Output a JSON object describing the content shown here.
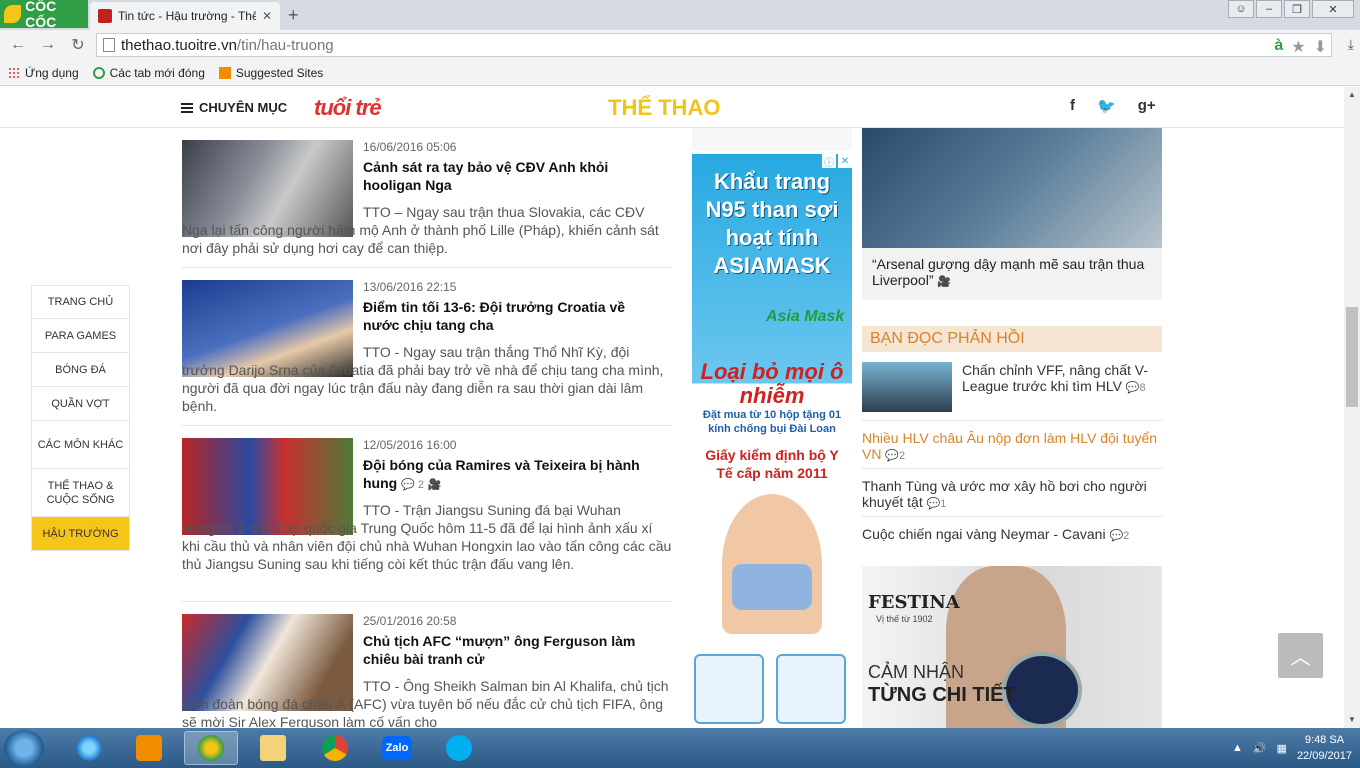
{
  "browser": {
    "brand": "CỐC CỐC",
    "tab_title": "Tin tức - Hậu trường - Thể",
    "url_host": "thethao.tuoitre.vn",
    "url_path": "/tin/hau-truong",
    "bookmarks": [
      "Ứng dụng",
      "Các tab mới đóng",
      "Suggested Sites"
    ]
  },
  "header": {
    "menu_label": "CHUYÊN MỤC",
    "logo": "tuổi trẻ",
    "section": "THỂ THAO"
  },
  "nav": [
    "TRANG CHỦ",
    "PARA GAMES",
    "BÓNG ĐÁ",
    "QUẦN VỢT",
    "CÁC MÔN KHÁC",
    "THỂ THAO & CUỘC SỐNG",
    "HẬU TRƯỜNG"
  ],
  "articles": [
    {
      "date": "16/06/2016 05:06",
      "title": "Cảnh sát ra tay bảo vệ CĐV Anh khỏi hooligan Nga",
      "comments": "",
      "summary": "TTO – Ngay sau trận thua Slovakia, các CĐV Nga lại tấn công người hâm mộ Anh ở thành phố Lille (Pháp), khiến cảnh sát nơi đây phải sử dụng hơi cay để can thiệp."
    },
    {
      "date": "13/06/2016 22:15",
      "title": "Điểm tin tối 13-6: Đội trưởng Croatia về nước chịu tang cha",
      "comments": "",
      "summary": "TTO - Ngay sau trận thắng Thổ Nhĩ Kỳ, đội trưởng Darijo Srna của Croatia đã phải bay trở về nhà để chịu tang cha mình, người đã qua đời ngay lúc trận đấu này đang diễn ra sau thời gian dài lâm bệnh."
    },
    {
      "date": "12/05/2016 16:00",
      "title": "Đội bóng của Ramires và Teixeira bị hành hung",
      "comments": "2",
      "summary": "TTO - Trận Jiangsu Suning đá bại Wuhan Hongxin 1-0 ở Cúp quốc gia Trung Quốc hôm 11-5 đã để lại hình ảnh xấu xí khi cầu thủ và nhân viên đội chủ nhà Wuhan Hongxin lao vào tấn công các cầu thủ Jiangsu Suning sau khi tiếng còi kết thúc trận đấu vang lên."
    },
    {
      "date": "25/01/2016 20:58",
      "title": "Chủ tịch AFC “mượn” ông Ferguson làm chiêu bài tranh cử",
      "comments": "",
      "summary": "TTO - Ông Sheikh Salman bin Al Khalifa, chủ tịch Liên đoàn bóng đá châu Á (AFC) vừa tuyên bố nếu đắc cử chủ tịch FIFA, ông sẽ mời Sir Alex Ferguson làm cố vấn cho"
    }
  ],
  "ad": {
    "headline": "Khẩu trang N95 than sợi hoạt tính ASIAMASK",
    "brand": "Asia Mask",
    "slogan": "Loại bỏ mọi ô nhiễm",
    "promo": "Đặt mua từ 10 hộp tặng 01 kính chống bụi Đài Loan",
    "cert": "Giấy kiểm định bộ Y Tế cấp năm 2011"
  },
  "right": {
    "feature_caption": "“Arsenal gượng dậy mạnh mẽ sau trận thua Liverpool”",
    "feedback_title": "BẠN ĐỌC PHẢN HỒI",
    "feedback": [
      {
        "text": "Chấn chỉnh VFF, nâng chất V-League trước khi tìm HLV",
        "count": "8"
      },
      {
        "text": "Nhiều HLV châu Âu nộp đơn làm HLV đội tuyển VN",
        "count": "2"
      },
      {
        "text": "Thanh Tùng và ước mơ xây hồ bơi cho người khuyết tật",
        "count": "1"
      },
      {
        "text": "Cuộc chiến ngai vàng Neymar - Cavani",
        "count": "2"
      }
    ],
    "festina": {
      "brand": "FESTINA",
      "tagline": "Vị thế từ 1902",
      "line1": "CẢM NHẬN",
      "line2": "TỪNG CHI TIẾT"
    }
  },
  "taskbar": {
    "time": "9:48 SA",
    "date": "22/09/2017",
    "zalo": "Zalo"
  }
}
